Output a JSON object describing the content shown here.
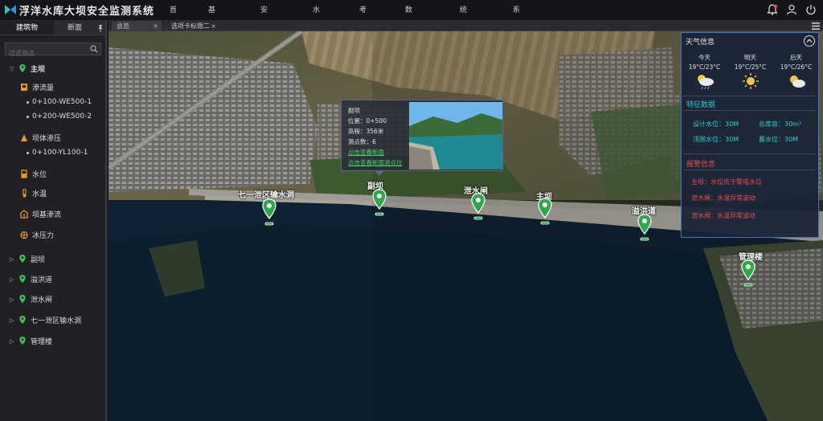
{
  "app": {
    "title": "浮洋水库大坝安全监测系统"
  },
  "menu": [
    "首页(H)",
    "基本信息(I)",
    "安全监测(M)",
    "水雨情(R)",
    "考证表(T)",
    "数据录入(D)",
    "统计报表(C)",
    "系统管理(S)"
  ],
  "top_icons": [
    "bell-icon",
    "user-icon",
    "power-icon"
  ],
  "left_tabs": {
    "active": "建筑物",
    "inactive": "断面",
    "pin": "📌"
  },
  "search": {
    "placeholder": "过滤测点"
  },
  "tree": {
    "main_dam": "主坝",
    "seepage": "渗流量",
    "seepage_items": [
      "0+100-WE500-1",
      "0+200-WE500-2"
    ],
    "dam_pressure": "坝体渗压",
    "dam_pressure_items": [
      "0+100-YL100-1"
    ],
    "water_level": "水位",
    "water_temp": "水温",
    "foundation_seepage": "坝基渗流",
    "earth_pressure": "冰压力",
    "collapsed": [
      "副坝",
      "溢洪道",
      "泄水闸",
      "七一泄区输水洞",
      "管理楼"
    ]
  },
  "map_tabs": {
    "tab1": "总览",
    "tab2": "选项卡标题二",
    "close": "×"
  },
  "markers": [
    "七一泄区输水洞",
    "副坝",
    "泄水闸",
    "主坝",
    "溢洪道",
    "管理楼"
  ],
  "popup": {
    "name": "副坝",
    "position": "位置：0+500",
    "elevation": "高程：356米",
    "points": "测点数：6",
    "link1": "点击查看断面",
    "link2": "点击查看断面测点位"
  },
  "info_panel": {
    "weather_title": "天气信息",
    "days": [
      {
        "label": "今天",
        "temp": "19°C/23°C",
        "icon": "cloud-rain-sun-icon"
      },
      {
        "label": "明天",
        "temp": "19°C/25°C",
        "icon": "sun-icon"
      },
      {
        "label": "后天",
        "temp": "19°C/26°C",
        "icon": "partly-cloudy-icon"
      }
    ],
    "feature_title": "特征数据",
    "features": [
      "设计水位：30M",
      "总库容：30m³",
      "汛限水位：30M",
      "蓄水位：30M"
    ],
    "alarm_title": "报警信息",
    "alarms": [
      "主坝：水位低于警戒水位",
      "泄水闸：水温异常波动",
      "泄水闸：水温异常波动"
    ]
  },
  "colors": {
    "accent_cyan": "#2ec5c5",
    "alarm_red": "#e84d4d",
    "marker_green": "#2ea84a",
    "panel_border": "#3e74c9"
  }
}
